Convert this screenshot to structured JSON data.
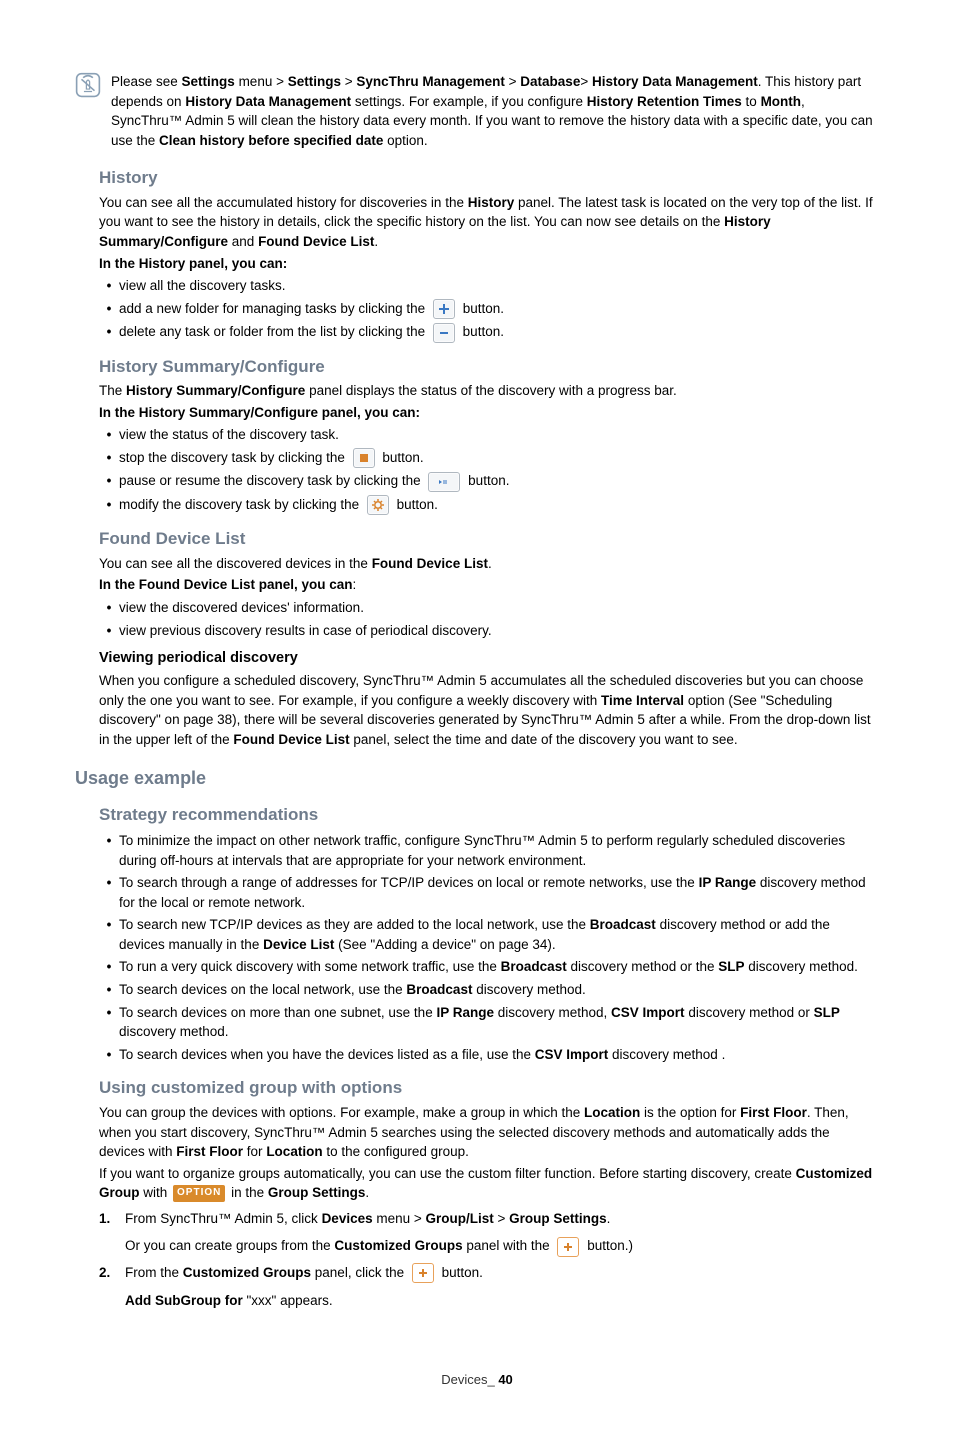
{
  "note": {
    "p1a": "Please see ",
    "p1b": "Settings",
    "p1c": " menu > ",
    "p1d": "Settings",
    "p1e": " > ",
    "p1f": "SyncThru Management",
    "p1g": " > ",
    "p1h": "Database",
    "p1i": "> ",
    "p1j": "History Data Management",
    "p1k": ". This history part depends on ",
    "p1l": "History Data Management",
    "p1m": " settings. For example, if you configure ",
    "p1n": "History Retention Times",
    "p1o": " to ",
    "p1p": "Month",
    "p1q": ", SyncThru™ Admin 5 will clean the history data every month. If you want to remove the history data with a specific date, you can use the ",
    "p1r": "Clean history before specified date",
    "p1s": " option."
  },
  "history": {
    "title": "History",
    "intro_a": "You can see all the accumulated history for discoveries in the ",
    "intro_b": "History",
    "intro_c": " panel. The latest task is located on the very top of the list. If you want to see the history in details, click the specific history on the list. You can now see details on the ",
    "intro_d": "History Summary/Configure",
    "intro_e": " and ",
    "intro_f": "Found Device List",
    "intro_g": ".",
    "can": "In the History panel, you can:",
    "li1": "view all the discovery tasks.",
    "li2a": "add a new folder for managing tasks by clicking the ",
    "li2b": " button.",
    "li3a": "delete any task or folder from the list by clicking the ",
    "li3b": " button."
  },
  "hsc": {
    "title": "History Summary/Configure",
    "intro_a": "The ",
    "intro_b": "History Summary/Configure",
    "intro_c": " panel displays the status of the discovery with a progress bar.",
    "can": "In the History Summary/Configure panel, you can:",
    "li1": "view the status of the discovery task.",
    "li2a": "stop the discovery task by clicking the ",
    "li2b": " button.",
    "li3a": "pause or resume the discovery task by clicking the ",
    "li3b": " button.",
    "li4a": "modify the discovery task by clicking the ",
    "li4b": " button."
  },
  "fdl": {
    "title": "Found Device List",
    "intro_a": "You can see all the discovered devices in the ",
    "intro_b": "Found Device List",
    "intro_c": ".",
    "can": "In the Found Device List panel, you can",
    "can_colon": ":",
    "li1": "view the discovered devices' information.",
    "li2": "view previous discovery results in case of periodical discovery."
  },
  "vpd": {
    "title": "Viewing periodical discovery",
    "p_a": "When you configure a scheduled discovery, SyncThru™ Admin 5 accumulates all the scheduled discoveries but you can choose only the one you want to see. For example, if you configure a weekly discovery with ",
    "p_b": "Time Interval",
    "p_c": " option (See \"Scheduling discovery\" on page 38), there will be several discoveries generated by SyncThru™ Admin 5 after a while. From the drop-down list in the upper left of the ",
    "p_d": "Found Device List",
    "p_e": " panel, select the time and date of the discovery you want to see."
  },
  "usage": {
    "title": "Usage example"
  },
  "strat": {
    "title": "Strategy recommendations",
    "li1": "To minimize the impact on other network traffic, configure SyncThru™ Admin 5 to perform regularly scheduled discoveries during off-hours at intervals that are appropriate for your network environment.",
    "li2a": "To search through a range of addresses for TCP/IP devices on local or remote networks, use the ",
    "li2b": "IP Range",
    "li2c": " discovery method for the local or remote network.",
    "li3a": "To search new TCP/IP devices as they are added to the local network, use the ",
    "li3b": "Broadcast",
    "li3c": " discovery method or add the devices manually in the ",
    "li3d": "Device List",
    "li3e": " (See \"Adding a device\" on page 34).",
    "li4a": "To run a very quick discovery with some network traffic, use the ",
    "li4b": "Broadcast",
    "li4c": " discovery method or the ",
    "li4d": "SLP",
    "li4e": " discovery method.",
    "li5a": "To search devices on the local network, use the ",
    "li5b": "Broadcast",
    "li5c": " discovery method.",
    "li6a": "To search devices on more than one subnet, use the ",
    "li6b": "IP Range",
    "li6c": " discovery method, ",
    "li6d": "CSV Import",
    "li6e": " discovery method or ",
    "li6f": "SLP",
    "li6g": " discovery method.",
    "li7a": "To search devices when you have the devices listed as a file, use the ",
    "li7b": "CSV Import",
    "li7c": " discovery method ."
  },
  "custom": {
    "title": "Using customized group with options",
    "p1a": "You can group the devices with options. For example, make a group in which the ",
    "p1b": "Location",
    "p1c": " is the option for ",
    "p1d": "First Floor",
    "p1e": ". Then, when you start discovery, SyncThru™ Admin 5 searches using the selected discovery methods and automatically adds the devices with ",
    "p1f": "First Floor",
    "p1g": " for ",
    "p1h": "Location",
    "p1i": " to the configured group.",
    "p2a": "If you want to organize groups automatically, you can use the custom filter function. Before starting discovery, create ",
    "p2b": "Customized Group",
    "p2c": " with ",
    "p2d": "OPTION",
    "p2e": " in the ",
    "p2f": "Group Settings",
    "p2g": ".",
    "s1a": "From SyncThru™ Admin 5, click ",
    "s1b": "Devices",
    "s1c": " menu > ",
    "s1d": "Group/List",
    "s1e": " > ",
    "s1f": "Group Settings",
    "s1g": ".",
    "s1sub_a": "Or you can create groups from the ",
    "s1sub_b": "Customized Groups",
    "s1sub_c": " panel with the ",
    "s1sub_d": " button.)",
    "s2a": "From the ",
    "s2b": "Customized Groups",
    "s2c": " panel, click the ",
    "s2d": " button.",
    "s2sub_a": "Add SubGroup for",
    "s2sub_b": " \"xxx\" appears."
  },
  "footer": {
    "label": "Devices",
    "sep": "_ ",
    "page": "40"
  }
}
